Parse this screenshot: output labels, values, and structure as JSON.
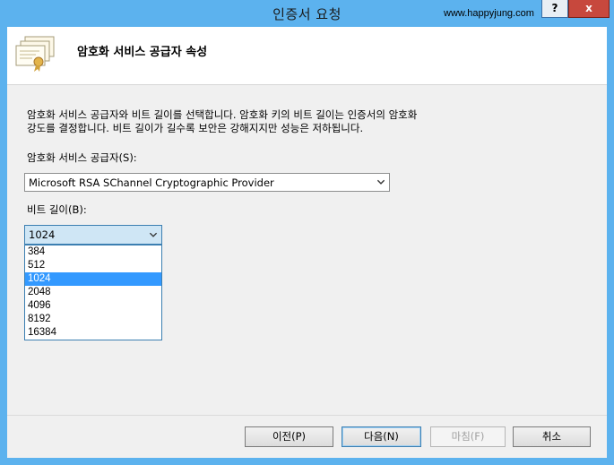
{
  "window": {
    "title": "인증서 요청",
    "watermark": "www.happyjung.com",
    "help_label": "?",
    "close_label": "x"
  },
  "header": {
    "title": "암호화 서비스 공급자 속성"
  },
  "description": {
    "line1": "암호화 서비스 공급자와 비트 길이를 선택합니다. 암호화 키의 비트 길이는 인증서의 암호화",
    "line2": "강도를 결정합니다. 비트 길이가 길수록 보안은 강해지지만 성능은 저하됩니다."
  },
  "provider": {
    "label": "암호화 서비스 공급자(S):",
    "selected": "Microsoft RSA SChannel Cryptographic Provider"
  },
  "bit_length": {
    "label": "비트 길이(B):",
    "selected": "1024",
    "options": [
      "384",
      "512",
      "1024",
      "2048",
      "4096",
      "8192",
      "16384"
    ]
  },
  "buttons": {
    "previous": "이전(P)",
    "next": "다음(N)",
    "finish": "마침(F)",
    "cancel": "취소"
  }
}
